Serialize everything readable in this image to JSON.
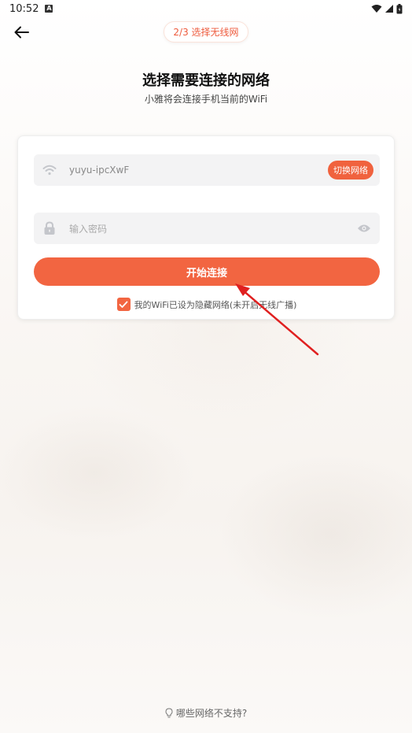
{
  "status_bar": {
    "time": "10:52"
  },
  "header": {
    "step_label": "2/3 选择无线网"
  },
  "main": {
    "title": "选择需要连接的网络",
    "subtitle": "小雅将会连接手机当前的WiFi"
  },
  "form": {
    "wifi_name": "yuyu-ipcXwF",
    "switch_label": "切换网络",
    "password_placeholder": "输入密码",
    "password_value": "",
    "connect_label": "开始连接",
    "hidden_network_checked": true,
    "hidden_network_label": "我的WiFi已设为隐藏网络(未开启无线广播)"
  },
  "footer": {
    "help_label": "哪些网络不支持?"
  },
  "colors": {
    "accent": "#f26541",
    "annotation": "#e02020"
  }
}
